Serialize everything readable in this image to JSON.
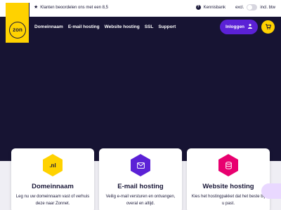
{
  "topbar": {
    "rating_text": "Klanten beoordelen ons met een 8,5",
    "help_icon_glyph": "?",
    "help_label": "Kennisbank",
    "vat_off_label": "excl.",
    "vat_on_label": "incl. btw"
  },
  "logo": {
    "text": "zon",
    "color": "#ffd200"
  },
  "nav": {
    "items": [
      "Domeinnaam",
      "E-mail hosting",
      "Website hosting",
      "SSL",
      "Support"
    ]
  },
  "header": {
    "login_label": "Inloggen",
    "login_color": "#5b21d6",
    "cart_color": "#ffd200"
  },
  "cards": [
    {
      "icon_label": ".nl",
      "icon_color": "#ffd200",
      "title": "Domeinnaam",
      "text": "Leg nu uw domeinnaam vast of verhuis deze naar Zonnet."
    },
    {
      "icon_color": "#5b21d6",
      "title": "E-mail hosting",
      "text": "Veilig e-mail versturen en ontvangen, overal en altijd."
    },
    {
      "icon_color": "#e8006f",
      "title": "Website hosting",
      "text": "Kies het hostingpakket dat het beste bij u past."
    }
  ],
  "colors": {
    "hero_background": "#171433",
    "text_dark": "#1a1838"
  }
}
